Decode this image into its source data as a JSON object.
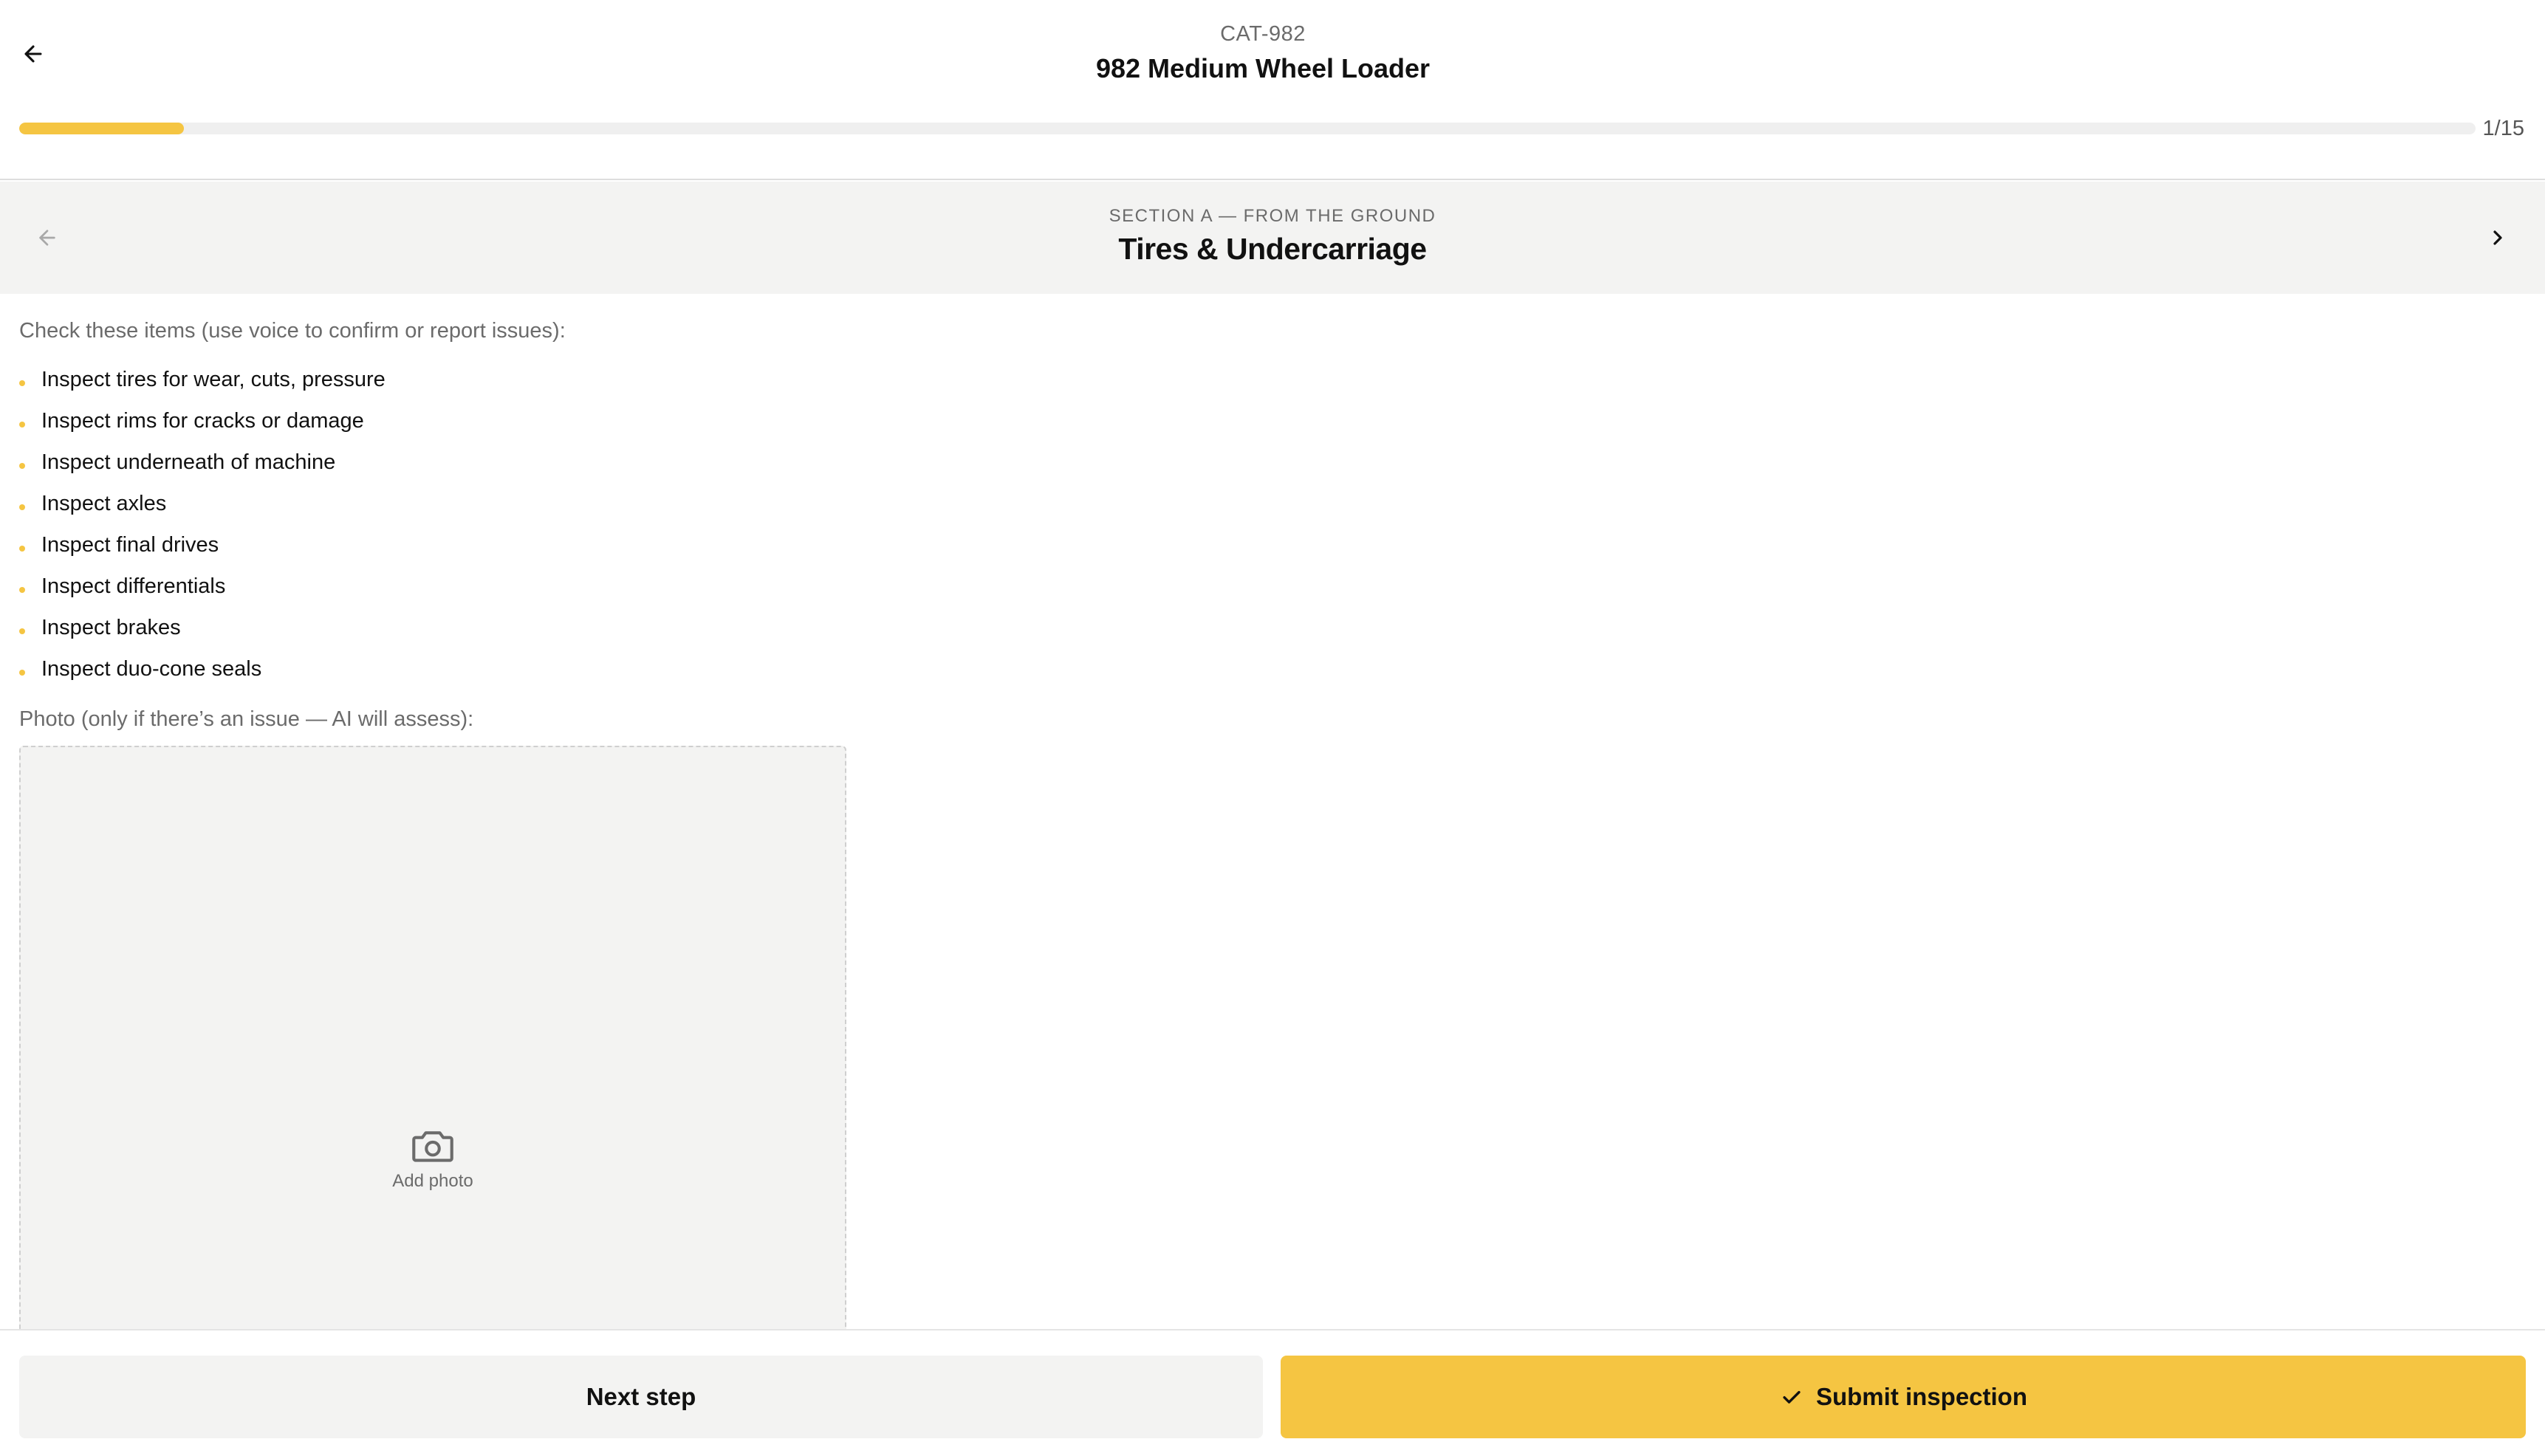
{
  "header": {
    "machine_code": "CAT-982",
    "machine_name": "982 Medium Wheel Loader",
    "progress_text": "1/15",
    "progress_fraction": 0.067
  },
  "section": {
    "eyebrow": "SECTION A — FROM THE GROUND",
    "title": "Tires & Undercarriage"
  },
  "body": {
    "instructions": "Check these items (use voice to confirm or report issues):",
    "items": [
      "Inspect tires for wear, cuts, pressure",
      "Inspect rims for cracks or damage",
      "Inspect underneath of machine",
      "Inspect axles",
      "Inspect final drives",
      "Inspect differentials",
      "Inspect brakes",
      "Inspect duo-cone seals"
    ],
    "photo_label": "Photo (only if there’s an issue — AI will assess):",
    "add_photo": "Add photo"
  },
  "footer": {
    "next_label": "Next step",
    "submit_label": "Submit inspection"
  },
  "icons": {
    "back": "arrow-left-icon",
    "prev_section": "arrow-left-icon",
    "next_section": "chevron-right-icon",
    "camera": "camera-icon",
    "check": "check-icon"
  },
  "colors": {
    "accent": "#f5c542",
    "panel": "#f3f3f2",
    "muted_text": "#6b6b6b"
  }
}
